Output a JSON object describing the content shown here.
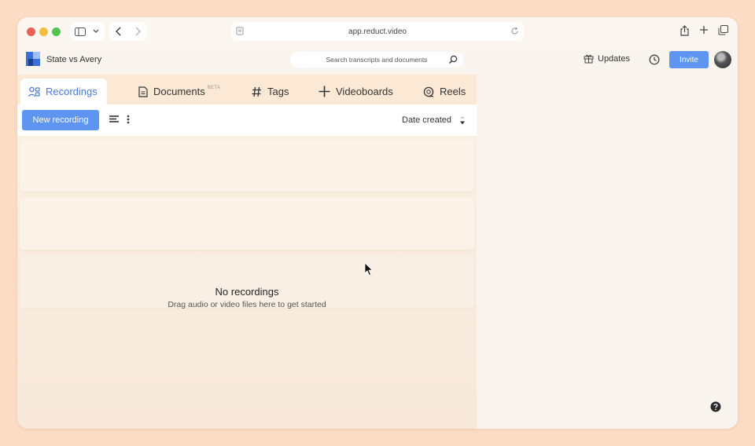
{
  "browser": {
    "url": "app.reduct.video"
  },
  "header": {
    "project_title": "State vs Avery",
    "search_placeholder": "Search transcripts and documents",
    "updates_label": "Updates",
    "invite_label": "Invite"
  },
  "tabs": [
    {
      "label": "Recordings",
      "icon": "people-icon",
      "active": true
    },
    {
      "label": "Documents",
      "icon": "document-icon",
      "badge": "BETA"
    },
    {
      "label": "Tags",
      "icon": "hash-icon"
    },
    {
      "label": "Videoboards",
      "icon": "plus-icon"
    },
    {
      "label": "Reels",
      "icon": "reel-icon"
    }
  ],
  "toolbar": {
    "new_recording_label": "New recording",
    "sort_label": "Date created"
  },
  "empty_state": {
    "title": "No recordings",
    "subtitle": "Drag audio or video files here to get started"
  },
  "colors": {
    "accent": "#5e95f0",
    "active_tab_text": "#4a7ad6",
    "page_background": "#fcdcc4"
  }
}
